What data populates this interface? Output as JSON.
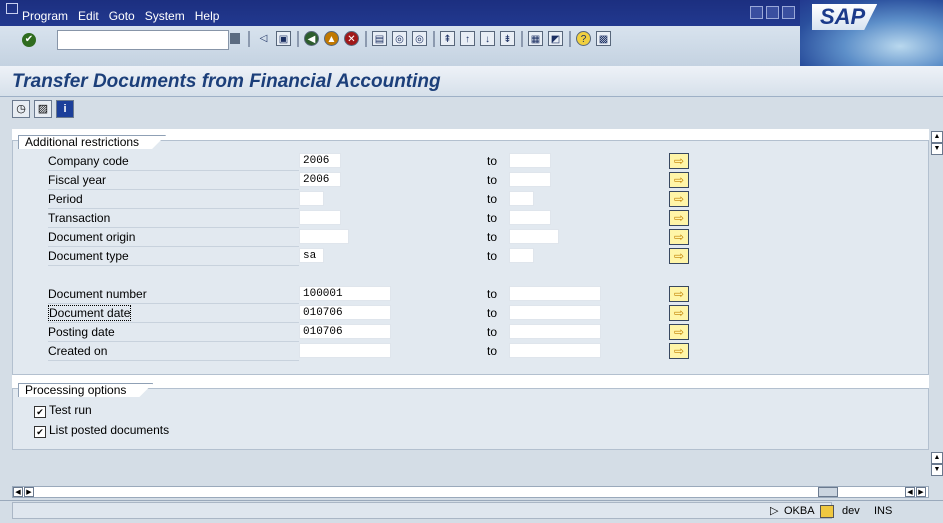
{
  "menu": {
    "items": [
      "Program",
      "Edit",
      "Goto",
      "System",
      "Help"
    ],
    "logo": "SAP"
  },
  "page_title": "Transfer Documents from Financial Accounting",
  "restrictions": {
    "title": "Additional restrictions",
    "to_label": "to",
    "rows": [
      {
        "label": "Company code",
        "from": "2006",
        "to": ""
      },
      {
        "label": "Fiscal year",
        "from": "2006",
        "to": ""
      },
      {
        "label": "Period",
        "from": "",
        "to": ""
      },
      {
        "label": "Transaction",
        "from": "",
        "to": ""
      },
      {
        "label": "Document origin",
        "from": "",
        "to": ""
      },
      {
        "label": "Document type",
        "from": "sa",
        "to": ""
      },
      {
        "label": "Document number",
        "from": "100001",
        "to": ""
      },
      {
        "label": "Document date",
        "from": "010706",
        "to": ""
      },
      {
        "label": "Posting date",
        "from": "010706",
        "to": ""
      },
      {
        "label": "Created on",
        "from": "",
        "to": ""
      }
    ]
  },
  "processing": {
    "title": "Processing options",
    "options": [
      {
        "label": "Test run",
        "checked": true
      },
      {
        "label": "List posted documents",
        "checked": true
      }
    ]
  },
  "status": {
    "transaction": "OKBA",
    "system": "dev",
    "mode": "INS"
  },
  "colors": {
    "menubar": "#22398f",
    "title": "#1c3f7a",
    "group_bg": "#e2e9f0"
  }
}
